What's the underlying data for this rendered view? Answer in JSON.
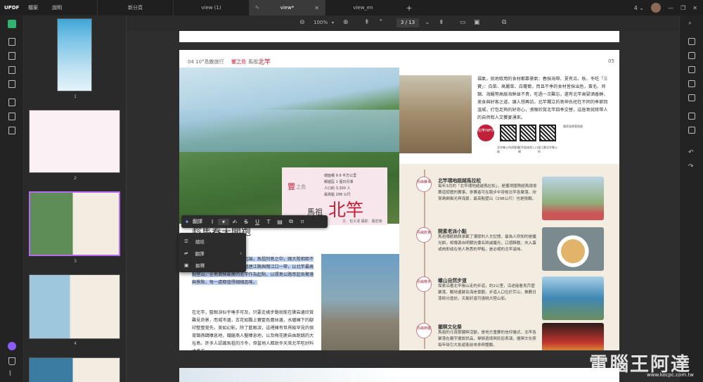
{
  "titlebar": {
    "logo": "UPDF",
    "menu": [
      "檔案",
      "說明"
    ],
    "tabs": [
      {
        "label": "新分頁",
        "active": false
      },
      {
        "label": "view (1)",
        "active": false
      },
      {
        "label": "view*",
        "active": true
      },
      {
        "label": "view_en",
        "active": false
      }
    ],
    "plus": "+",
    "count": "4",
    "chevron": "⌄"
  },
  "doc_toolbar": {
    "zoom": "100%",
    "page_current": "3",
    "page_total": "13",
    "page_label": "3 / 13"
  },
  "thumbnails": [
    {
      "num": "1"
    },
    {
      "num": "2"
    },
    {
      "num": "3"
    },
    {
      "num": "4"
    },
    {
      "num": "5"
    }
  ],
  "page": {
    "header_left": "04  10°島散旅行",
    "header_mid": "響之島",
    "header_region": "馬祖",
    "header_north": "北竿",
    "page_num": "05",
    "big_title_prefix": "豐",
    "big_title_small": "之島",
    "big_title_mazu": "馬祖",
    "big_title_main": "北竿",
    "subtitle": "文．包子湯  攝影．羅宏傑",
    "stats": [
      "總面積 9.9 平方公里",
      "郵遞區 1 個日月潭",
      "人口約 3,300 人",
      "最高點 298 公尺"
    ],
    "headline": "趁馬春天開跑",
    "paragraph_hl": "北竿位處北竿鄉在台灣海峽北端，馬祖列島之中，跟大陸相距不遠，晴空時仍可看到中國大陸連江縣與閩江口一帶，以北竿最高點壁山，全島面積最廣的北竿作為起點，以環島公路串起各聚落與景點，每一處都值得細細品味。",
    "paragraph_rest": "在北竿，藍眼淚似乎唾手可及，只要走幾步路就能在礁岩邊欣賞難見奇景，而城市邊，古花如飄上寶藍色層絲邊，水纏擁下的腳印整整覺先，美如幻影。除了藍眼淚，這裡擁有世界級罕見的保育類燕鷗棲息地，鐵龍燕人鑿棲息地，以及梅花鹿自由跑跳的大坵島。許多人認識馬祖的冷冬，但當地人都說冬天來北竿吃好料才真正",
    "right_top_text": "福氣，就地取用的食材都靠豪氣：春採海帶、夏有瓜、秋、冬吃「三寶」：白菜、高麗菜、白蘿蔔，而且不季的食材皆採出色，黃毛、貝類、海鱺等高級海鮮並不貴，吃過一次難忘，還有北竿高粱酒香醇，美食與好客之道，讓人想再訪。北竿獨立的島神氏祀在不同的季節回溫城，打包足夠的好奇心，張眼欣賞北竿四季交替，這座島就將帶人的自然和人文饗宴湧來。",
    "qr_labels": [
      "北竿鄉公所遊客服務",
      "北竿島旅遊入口網",
      "連江縣北竿鄉公所",
      "國家風景管理處"
    ],
    "info_circle": "北竿INFO",
    "sections": [
      {
        "tag": "島嶼賽事",
        "title": "北竿環地超越馬拉松",
        "body": "每年3月的「北竿環地超越馬拉松」，是獲得國際超馬總會賽道認證的賽事，參賽者可在跑步中穿梭北竿各聚落，欣賞島嶼風光與海景，最高點壁山（298公尺）也是挑戰。"
      },
      {
        "tag": "島嶼飲食",
        "title": "開素老派小點",
        "body": "馬祖傳統糕餅承載了濃厚的人文記憶，最為人所知的是繼光餅，相傳源自明朝抗倭名將戚繼光，口感酥脆，夾入蛋或肉即成在地人熟悉的早點，是必嚐的北竿滋味。"
      },
      {
        "tag": "島嶼散步",
        "title": "螺山自然步道",
        "body": "探索沿著北竿後山走的步道，約2公里，沿途能看見芹壁聚落、戰地遺跡及海岸景觀，步道入口位於芹山，推薦日落時分造訪，天氣好還可遠眺大陸山影。"
      },
      {
        "tag": "島嶼節慶",
        "title": "擺暝文化祭",
        "body": "馬祖的元宵節擺暝活動，是地方重要的信仰儀式，北竿各聚落在廟宇擺設供品，舉辦遶境與民俗表演，擺暝文化祭每年吸引大批遊客前來參與體驗。"
      }
    ]
  },
  "floating_toolbar": {
    "translate_label": "翻譯"
  },
  "context_menu": {
    "items": [
      "總結",
      "翻譯",
      "解釋"
    ]
  },
  "watermark": {
    "text": "電腦王阿達",
    "url": "www.kocpc.com.tw"
  }
}
